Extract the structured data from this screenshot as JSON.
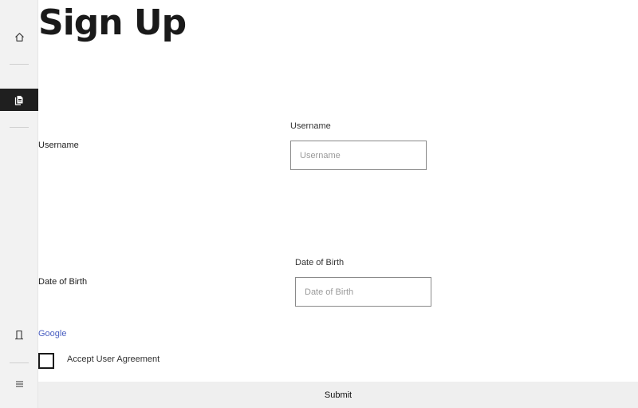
{
  "sidebar": {
    "items": [
      {
        "icon": "home-icon"
      },
      {
        "icon": "documents-icon",
        "active": true
      },
      {
        "icon": "door-icon"
      },
      {
        "icon": "menu-icon"
      }
    ]
  },
  "page": {
    "title": "Sign Up"
  },
  "form": {
    "username": {
      "row_label": "Username",
      "field_label": "Username",
      "placeholder": "Username",
      "value": ""
    },
    "dob": {
      "row_label": "Date of Birth",
      "field_label": "Date of Birth",
      "placeholder": "Date of Birth",
      "value": ""
    },
    "google_link": "Google",
    "agreement": {
      "label": "Accept User Agreement",
      "checked": false
    },
    "submit_label": "Submit"
  }
}
